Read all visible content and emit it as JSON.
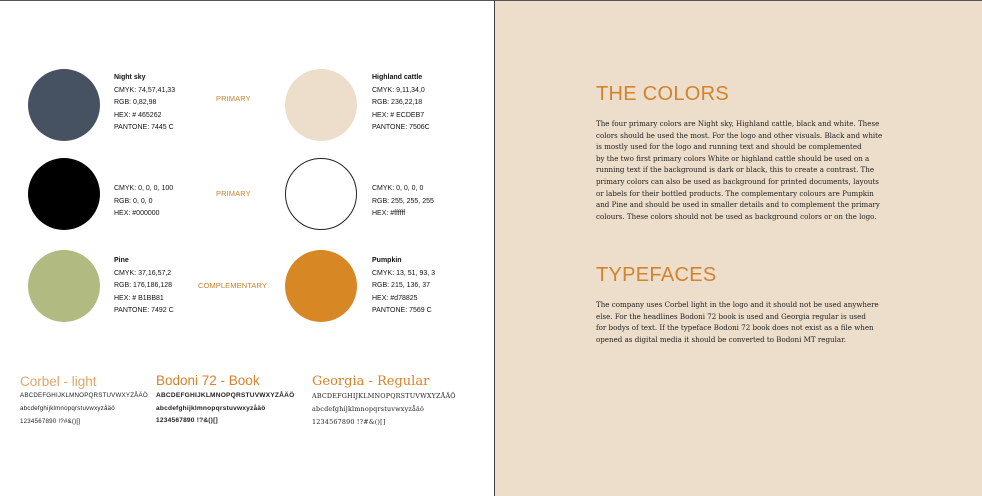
{
  "colors": {
    "primary_1": {
      "tag": "PRIMARY",
      "left": {
        "name": "Night sky",
        "cmyk": "CMYK: 74,57,41,33",
        "rgb": "RGB: 0,82,98",
        "hex": "HEX: # 465262",
        "pantone": "PANTONE:  7445 C",
        "swatch": "#465262"
      },
      "right": {
        "name": "Highland cattle",
        "cmyk": "CMYK: 9,11,34,0",
        "rgb": "RGB: 236,22,18",
        "hex": "HEX: # ECDEB7",
        "pantone": "PANTONE: 7506C",
        "swatch": "#ecdeca"
      }
    },
    "primary_2": {
      "tag": "PRIMARY",
      "left": {
        "cmyk": "CMYK: 0, 0, 0, 100",
        "rgb": "RGB: 0, 0, 0",
        "hex": "HEX: #000000",
        "swatch": "#000000"
      },
      "right": {
        "cmyk": "CMYK: 0, 0, 0, 0",
        "rgb": "RGB: 255, 255, 255",
        "hex": "HEX: #ffffff",
        "swatch": "#ffffff"
      }
    },
    "complementary": {
      "tag": "COMPLEMENTARY",
      "left": {
        "name": "Pine",
        "cmyk": "CMYK: 37,16,57,2",
        "rgb": "RGB: 176,186,128",
        "hex": "HEX: # B1BB81",
        "pantone": "PANTONE: 7492 C",
        "swatch": "#b1bb81"
      },
      "right": {
        "name": "Pumpkin",
        "cmyk": "CMYK:  13, 51, 93, 3",
        "rgb": "RGB: 215, 136, 37",
        "hex": "HEX: #d78825",
        "pantone": "PANTONE: 7569 C",
        "swatch": "#d78825"
      }
    }
  },
  "typefaces": {
    "corbel": {
      "title": "Corbel - light",
      "upper": "ABCDEFGHIJKLMNOPQRSTUVWXYZÅÄÖ",
      "lower": "abcdefghijklmnopqrstuvwxyzåäö",
      "digits": "1234567890 !?#&()[]"
    },
    "bodoni": {
      "title": "Bodoni 72 - Book",
      "upper": "ABCDEFGHIJKLMNOPQRSTUVWXYZÅÄÖ",
      "lower": "abcdefghijklmnopqrstuvwxyzåäö",
      "digits": "1234567890 !?&()[]"
    },
    "georgia": {
      "title": "Georgia - Regular",
      "upper": "ABCDEFGHIJKLMNOPQRSTUVWXYZÅÄÖ",
      "lower": "abcdefghijklmnopqrstuvwxyzåäö",
      "digits": "1234567890 !?#&()[]"
    }
  },
  "right_page": {
    "colors_heading": "THE COLORS",
    "colors_lines": [
      "The four primary colors are Night sky, Highland cattle, black and white. These",
      "colors should be used the most. For the logo and other visuals. Black and white",
      "is mostly used for the logo and running text and should be complemented",
      "by the two first primary colors White or highland cattle should be used on a",
      "running text if the background is dark or black, this to create a contrast. The",
      "primary colors can also be used as background for printed documents, layouts",
      "or labels for their bottled products. The complementary colours are Pumpkin",
      "and Pine and should be used in smaller details and to complement the primary",
      "colours. These colors should not be used as background colors or on the logo."
    ],
    "typefaces_heading": "TYPEFACES",
    "typefaces_lines": [
      "The company uses Corbel light in the logo and it should not be used anywhere",
      "else. For the headlines Bodoni 72 book is used and Georgia regular is used",
      "for bodys of text. If the typeface Bodoni 72 book does not exist as a file when",
      "opened as digital media it should be converted to Bodoni MT regular."
    ]
  }
}
